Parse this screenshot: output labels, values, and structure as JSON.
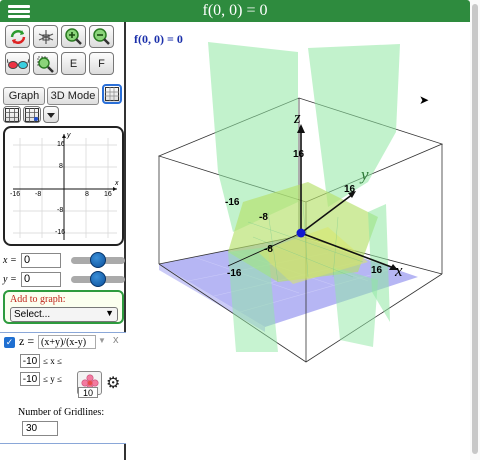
{
  "header": {
    "title": "f(0, 0) = 0",
    "menu_icon": "hamburger-icon",
    "bar_color": "#2e8b3e"
  },
  "toolbar": {
    "row1_icons": [
      "rotate-icon",
      "reset-axes-icon",
      "zoom-in-icon",
      "zoom-out-icon"
    ],
    "row2_icons": [
      "glasses-icon",
      "zoom-box-icon"
    ],
    "e_label": "E",
    "f_label": "F"
  },
  "modes": {
    "graph_label": "Graph",
    "mode3d_label": "3D Mode",
    "options": [
      "grid-plain-icon",
      "grid-dots-icon",
      "dropdown-arrow-icon"
    ]
  },
  "minigraph": {
    "x_ticks": [
      "-16",
      "-8",
      "8",
      "16"
    ],
    "y_ticks": [
      "16",
      "8",
      "-8",
      "-16"
    ],
    "x_label": "x",
    "y_label": "y"
  },
  "sliders": {
    "x": {
      "label": "x =",
      "value": "0"
    },
    "y": {
      "label": "y =",
      "value": "0"
    }
  },
  "add_to_graph": {
    "label": "Add to graph:",
    "selected": "Select..."
  },
  "function": {
    "checked": true,
    "lhs": "z =",
    "expression": "(x+y)/(x-y)",
    "remove_label": "x",
    "x_min": "-10",
    "x_max": "10",
    "y_min": "-10",
    "y_max": "10",
    "x_rel": "≤ x ≤",
    "y_rel": "≤ y ≤",
    "gridlines_label": "Number of Gridlines:",
    "gridlines_value": "30",
    "settings_icon": "gear-icon",
    "color_icon": "flower-color-icon"
  },
  "graph3d": {
    "value_label": "f(0, 0) = 0",
    "axis_z": "z",
    "axis_y": "y",
    "axis_x": "x",
    "z_ticks": [
      "16"
    ],
    "y_ticks": [
      "16"
    ],
    "x_ticks": [
      "-16",
      "16"
    ],
    "inner_ticks": [
      "-16",
      "-8",
      "-8"
    ],
    "surface_color": "#8fe8a3",
    "floor_color": "#a9a9f2",
    "origin_color": "#1018d0"
  }
}
